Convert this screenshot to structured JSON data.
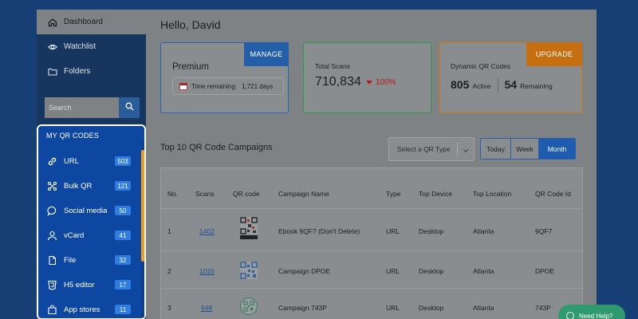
{
  "sidebar": {
    "nav": [
      {
        "label": "Dashboard",
        "icon": "home-icon"
      },
      {
        "label": "Watchlist",
        "icon": "eye-icon"
      },
      {
        "label": "Folders",
        "icon": "folder-icon"
      }
    ],
    "search_placeholder": "Search",
    "qr_section_title": "MY QR CODES",
    "qr_items": [
      {
        "label": "URL",
        "count": "503",
        "icon": "link-icon"
      },
      {
        "label": "Bulk QR",
        "count": "121",
        "icon": "bulk-icon"
      },
      {
        "label": "Social media",
        "count": "50",
        "icon": "chat-icon"
      },
      {
        "label": "vCard",
        "count": "41",
        "icon": "user-icon"
      },
      {
        "label": "File",
        "count": "32",
        "icon": "file-icon"
      },
      {
        "label": "H5 editor",
        "count": "17",
        "icon": "h5-icon"
      },
      {
        "label": "App stores",
        "count": "11",
        "icon": "store-icon"
      }
    ]
  },
  "main": {
    "greeting": "Hello, David",
    "premium": {
      "title": "Premium",
      "manage_label": "MANAGE",
      "time_label": "Time remaining:",
      "time_value": "1,721 days"
    },
    "total_scans": {
      "label": "Total Scans",
      "value": "710,834",
      "delta": "100%"
    },
    "dynamic": {
      "label": "Dynamic QR Codes",
      "upgrade_label": "UPGRADE",
      "active_count": "805",
      "active_label": "Active",
      "remaining_count": "54",
      "remaining_label": "Remaining"
    },
    "campaigns_title": "Top 10 QR Code Campaigns",
    "select_placeholder": "Select a QR Type",
    "range_buttons": [
      "Today",
      "Week",
      "Month"
    ],
    "table": {
      "headers": [
        "No.",
        "Scans",
        "QR code",
        "Campaign Name",
        "Type",
        "Top Device",
        "Top Location",
        "QR Code Id"
      ],
      "rows": [
        {
          "no": "1",
          "scans": "1402",
          "name": "Ebook 9QF7 (Don't Delete)",
          "type": "URL",
          "device": "Desktop",
          "location": "Atlanta",
          "id": "9QF7"
        },
        {
          "no": "2",
          "scans": "1016",
          "name": "Campaign DPOE",
          "type": "URL",
          "device": "Desktop",
          "location": "Atlanta",
          "id": "DPOE"
        },
        {
          "no": "3",
          "scans": "948",
          "name": "Campaign 743P",
          "type": "URL",
          "device": "Desktop",
          "location": "Atlanta",
          "id": "743P"
        }
      ]
    },
    "help_label": "Need Help?"
  },
  "colors": {
    "accent": "#1f5cb0",
    "premium_border": "#2a63bd",
    "scans_border": "#2f9a4a",
    "dynamic_border": "#d27a10",
    "upgrade": "#c66e10",
    "delta_down": "#b31b1b",
    "badge": "#2f7de1",
    "scroll_thumb": "#f39b1f"
  }
}
